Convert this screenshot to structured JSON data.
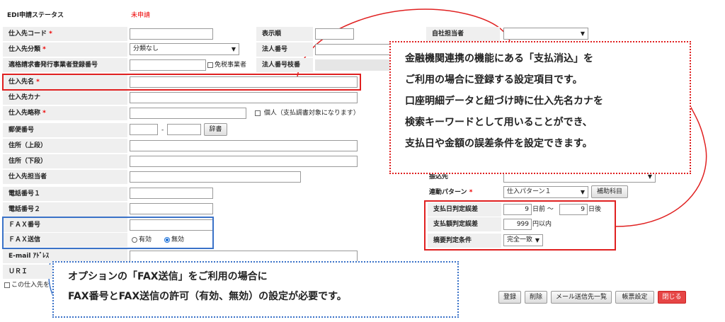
{
  "fields": {
    "edi_status_label": "EDI申請ステータス",
    "edi_status_value": "未申請",
    "supplier_code_label": "仕入先コード",
    "display_order_label": "表示順",
    "own_staff_label": "自社担当者",
    "supplier_category_label": "仕入先分類",
    "supplier_category_value": "分類なし",
    "corporate_number_label": "法人番号",
    "invoice_number_label": "適格請求書発行事業者登録番号",
    "tax_exempt_label": "免税事業者",
    "corporate_branch_label": "法人番号枝番",
    "supplier_name_label": "仕入先名",
    "supplier_kana_label": "仕入先カナ",
    "supplier_short_label": "仕入先略称",
    "individual_label": "個人（支払調書対象になります）",
    "postal_code_label": "郵便番号",
    "postal_dash": "-",
    "dictionary_button": "辞書",
    "address1_label": "住所（上段）",
    "address2_label": "住所（下段）",
    "supplier_staff_label": "仕入先担当者",
    "phone1_label": "電話番号１",
    "phone2_label": "電話番号２",
    "fax_number_label": "ＦＡＸ番号",
    "fax_send_label": "ＦＡＸ送信",
    "fax_send_enabled": "有効",
    "fax_send_disabled": "無効",
    "email_label": "E-mail ｱﾄﾞﾚｽ",
    "uri_label": "ＵＲＩ",
    "checkbox_bottom_label": "この仕入先を",
    "required_mark": "*"
  },
  "right_panel": {
    "transfer_label": "振込先",
    "link_pattern_label": "連動パターン",
    "link_pattern_value": "仕入パターン１",
    "aux_account_button": "補助科目",
    "pay_date_tolerance_label": "支払日判定誤差",
    "pay_date_before_value": "9",
    "pay_date_before_unit": "日前 〜",
    "pay_date_after_value": "9",
    "pay_date_after_unit": "日後",
    "amount_tolerance_label": "支払額判定誤差",
    "amount_tolerance_value": "999",
    "amount_tolerance_unit": "円以内",
    "summary_condition_label": "摘要判定条件",
    "summary_condition_value": "完全一致"
  },
  "footer_buttons": {
    "register": "登録",
    "delete": "削除",
    "mail_list": "メール送信先一覧",
    "form_settings": "帳票設定",
    "close": "閉じる"
  },
  "callouts": {
    "red_lines": [
      "金融機関連携の機能にある「支払消込」を",
      "ご利用の場合に登録する設定項目です。",
      "口座明細データと紐づけ時に仕入先名カナを",
      "検索キーワードとして用いることができ、",
      "支払日や金額の誤差条件を設定できます。"
    ],
    "blue_lines": [
      "オプションの「FAX送信」をご利用の場合に",
      "FAX番号とFAX送信の許可（有効、無効）の設定が必要です。"
    ]
  },
  "colors": {
    "red_accent": "#e02020",
    "blue_accent": "#3a72c8",
    "label_bg": "#efefef"
  }
}
